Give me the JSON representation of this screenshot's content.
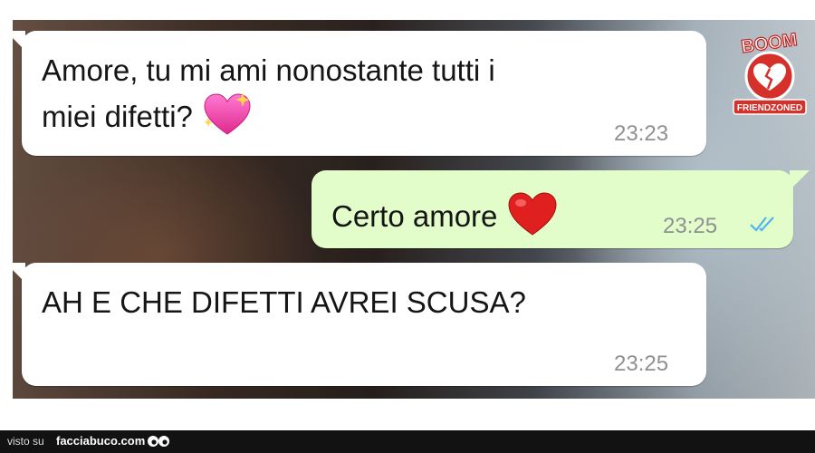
{
  "messages": [
    {
      "direction": "incoming",
      "line1": "Amore, tu mi ami nonostante tutti i",
      "line2": "miei difetti?",
      "emoji": "sparkling-heart",
      "time": "23:23"
    },
    {
      "direction": "outgoing",
      "text": "Certo amore",
      "emoji": "red-heart",
      "time": "23:25",
      "status": "read-double-check"
    },
    {
      "direction": "incoming",
      "text": "AH E CHE DIFETTI AVREI SCUSA?",
      "time": "23:25"
    }
  ],
  "watermark": {
    "logo_top_text": "BOOM",
    "logo_bottom_text": "FRIENDZONED"
  },
  "footer": {
    "visto_label": "visto su",
    "site_name": "facciabuco.com"
  },
  "colors": {
    "incoming_bubble": "#ffffff",
    "outgoing_bubble": "#e2fdc9",
    "timestamp": "#8e9094",
    "read_ticks": "#4fb6ec",
    "footer_bg": "#121212"
  }
}
